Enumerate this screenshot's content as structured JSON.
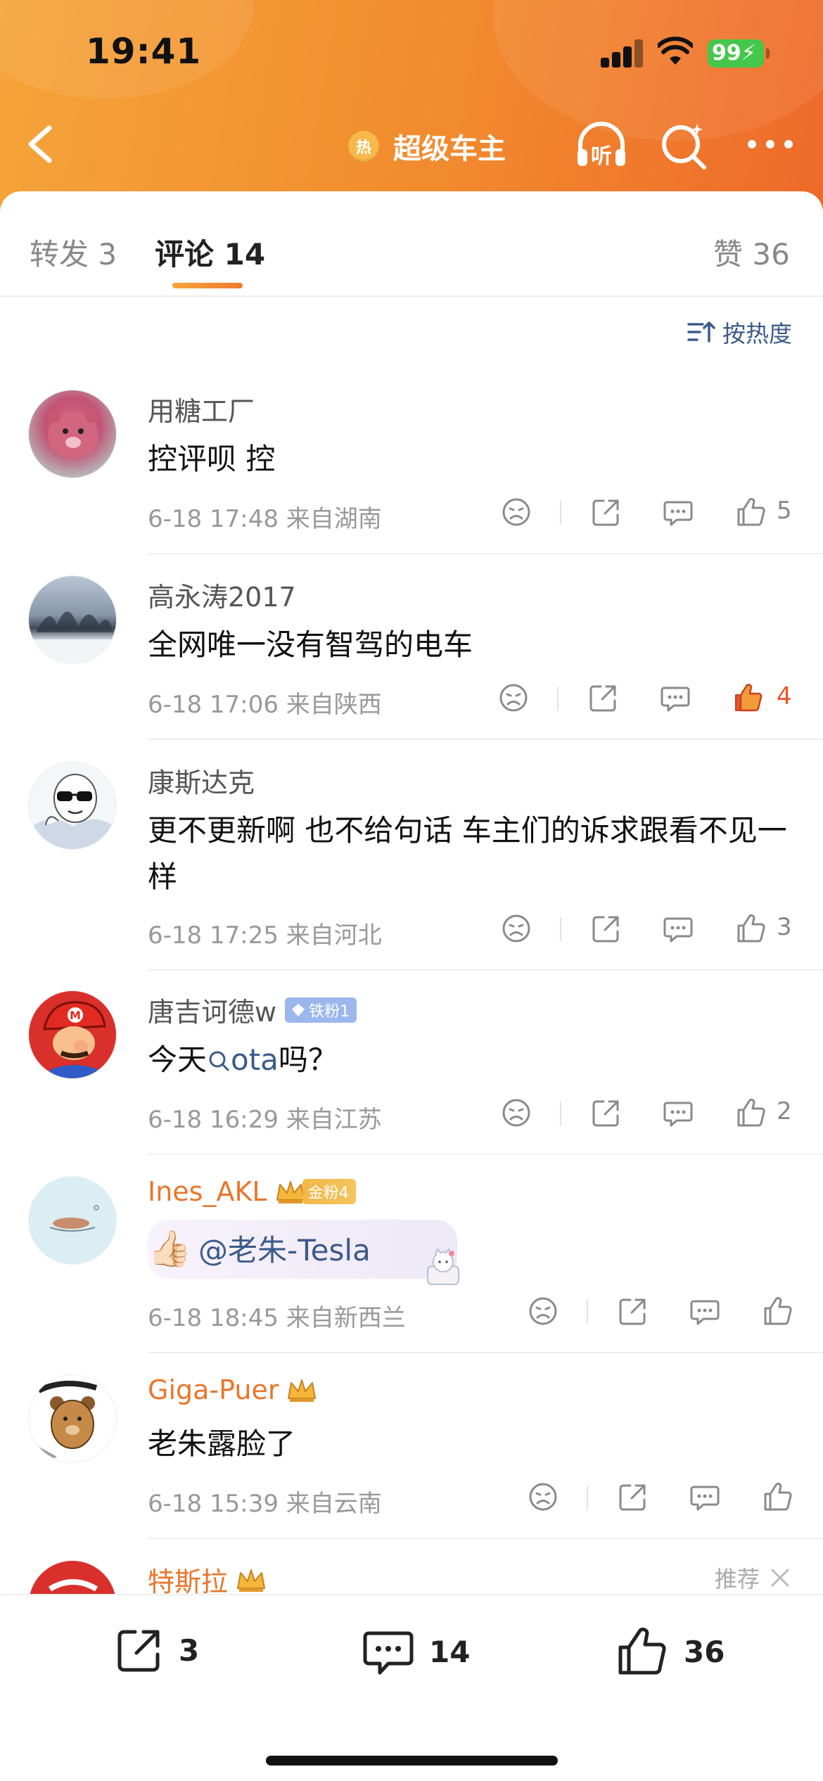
{
  "status_bar": {
    "time": "19:41",
    "battery": "99"
  },
  "nav": {
    "hot_badge": "热",
    "title": "超级车主",
    "listen_label": "听"
  },
  "tabs": {
    "repost": "转发 3",
    "comments": "评论 14",
    "likes": "赞 36"
  },
  "sort": {
    "label": "按热度"
  },
  "comments": [
    {
      "name": "用糖工厂",
      "text": "控评呗 控",
      "meta": "6-18 17:48  来自湖南",
      "likes": "5"
    },
    {
      "name": "高永涛2017",
      "text": "全网唯一没有智驾的电车",
      "meta": "6-18 17:06  来自陕西",
      "likes": "4"
    },
    {
      "name": "康斯达克",
      "text": "更不更新啊 也不给句话 车主们的诉求跟看不见一样",
      "meta": "6-18 17:25  来自河北",
      "likes": "3"
    },
    {
      "name": "唐吉诃德w",
      "badge": "铁粉1",
      "text_before": "今天",
      "text_link": "ota",
      "text_after": "吗？",
      "meta": "6-18 16:29  来自江苏",
      "likes": "2"
    },
    {
      "name": "Ines_AKL",
      "badge": "金粉4",
      "mention": "@老朱-Tesla",
      "meta": "6-18 18:45  来自新西兰",
      "likes": ""
    },
    {
      "name": "Giga-Puer",
      "text": "老朱露脸了",
      "meta": "6-18 15:39  来自云南",
      "likes": ""
    },
    {
      "name": "特斯拉",
      "recommend": "推荐"
    }
  ],
  "bottom_bar": {
    "reposts": "3",
    "comments": "14",
    "likes": "36"
  },
  "colors": {
    "accent_orange": "#f08a2e",
    "link_blue": "#3b5b8a",
    "like_active": "#e9542b"
  }
}
